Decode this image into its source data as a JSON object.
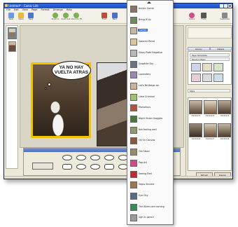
{
  "window": {
    "title": "Untitled* - Comic Life",
    "menu": [
      "File",
      "Edit",
      "View",
      "Page",
      "Format",
      "Arrange",
      "Help"
    ]
  },
  "toolbar": {
    "buttons": [
      {
        "label": "New",
        "icon": "new-document-icon",
        "color": "#6a9be0"
      },
      {
        "label": "Open",
        "icon": "open-folder-icon",
        "color": "#e6b93d"
      },
      {
        "label": "Save",
        "icon": "save-icon",
        "color": "#4b77c8"
      },
      {
        "label": "Zoom In",
        "icon": "zoom-in-icon",
        "color": "#7bb14e"
      },
      {
        "label": "Zoom Out",
        "icon": "zoom-out-icon",
        "color": "#7bb14e"
      },
      {
        "label": "Zoom to Fit",
        "icon": "zoom-fit-icon",
        "color": "#7bb14e"
      },
      {
        "label": "Front",
        "icon": "bring-front-icon",
        "color": "#c04b3a"
      },
      {
        "label": "Back",
        "icon": "send-back-icon",
        "color": "#4b6fc0"
      },
      {
        "label": "Colors",
        "icon": "colors-icon",
        "color": "#d24b8f"
      },
      {
        "label": "Fonts",
        "icon": "fonts-icon",
        "color": "#555555"
      },
      {
        "label": "Customize",
        "icon": "customize-icon",
        "color": "#888888"
      }
    ]
  },
  "canvas": {
    "speech_bubble": "YA NO HAY VUELTA ATRAS"
  },
  "right_panel": {
    "tabs": [
      "Library",
      "Details"
    ],
    "section": "Page Templates",
    "rows": [
      "Random Basic",
      "Style"
    ],
    "photos": [
      "DSC00123",
      "DSC00124",
      "DSC00125",
      "DSC00126",
      "DSC00127",
      "DSC00128"
    ],
    "buttons": [
      "Refresh",
      "Display"
    ]
  },
  "filter_menu": {
    "selected": "Comic",
    "items": [
      {
        "label": "Acrylic Comic",
        "color": "#8a7560"
      },
      {
        "label": "Bring It Up",
        "color": "#6d8a5c"
      },
      {
        "label": "Comic",
        "color": "#c8b7a0"
      },
      {
        "label": "Colored Pencil",
        "color": "#d9c79a"
      },
      {
        "label": "Glass Plate Negative",
        "color": "#b8b8b8"
      },
      {
        "label": "Graphite Sky",
        "color": "#6a7380"
      },
      {
        "label": "Lavenders",
        "color": "#9a87b8"
      },
      {
        "label": "Let's Be Beige-ish",
        "color": "#c9b390"
      },
      {
        "label": "Lime Criminal",
        "color": "#9fc36b"
      },
      {
        "label": "Marvelous",
        "color": "#b0543c"
      },
      {
        "label": "Night Vision Goggles",
        "color": "#4a7a3a"
      },
      {
        "label": "Not feeling well",
        "color": "#8f9a6a"
      },
      {
        "label": "Oil On Canvas",
        "color": "#8a5a3a"
      },
      {
        "label": "Old Skool",
        "color": "#9a8a70"
      },
      {
        "label": "Pop Art",
        "color": "#d04a8a"
      },
      {
        "label": "Seeing Red",
        "color": "#c02a2a"
      },
      {
        "label": "Sepia Sincere",
        "color": "#a07850"
      },
      {
        "label": "Eye City",
        "color": "#5a6a8a"
      },
      {
        "label": "The Aliens are coming",
        "color": "#3a8a5a"
      },
      {
        "label": "Ugh in pencil",
        "color": "#9a9a9a"
      }
    ]
  }
}
